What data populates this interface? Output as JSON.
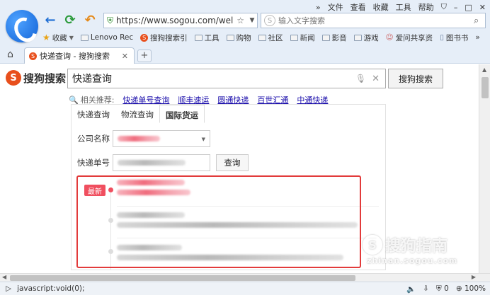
{
  "browser": {
    "menu": [
      "»",
      "文件",
      "查看",
      "收藏",
      "工具",
      "帮助"
    ],
    "window_controls": [
      "shirt-icon",
      "minimize",
      "maximize",
      "close"
    ],
    "address": "https://www.sogou.com/wel",
    "search_placeholder": "输入文字搜索",
    "bookmarks": [
      {
        "label": "收藏",
        "icon": "star-icon"
      },
      {
        "label": "Lenovo Rec",
        "icon": "folder-icon"
      },
      {
        "label": "搜狗搜索引",
        "icon": "sogou-icon"
      },
      {
        "label": "工具",
        "icon": "folder-icon"
      },
      {
        "label": "购物",
        "icon": "folder-icon"
      },
      {
        "label": "社区",
        "icon": "folder-icon"
      },
      {
        "label": "新闻",
        "icon": "folder-icon"
      },
      {
        "label": "影音",
        "icon": "folder-icon"
      },
      {
        "label": "游戏",
        "icon": "folder-icon"
      },
      {
        "label": "爱问共享资",
        "icon": "user-icon"
      },
      {
        "label": "图书书",
        "icon": "page-icon"
      }
    ],
    "tab_title": "快递查询 - 搜狗搜索",
    "status_url": "javascript:void(0);",
    "zoom": "100%",
    "status_count": "0"
  },
  "search": {
    "logo_text": "搜狗搜索",
    "query": "快递查询",
    "button": "搜狗搜索",
    "related_label": "相关推荐:",
    "related": [
      "快递单号查询",
      "顺丰速运",
      "圆通快递",
      "百世汇通",
      "中通快递"
    ]
  },
  "widget": {
    "tabs": [
      "快递查询",
      "物流查询",
      "国际货运"
    ],
    "active_tab": 2,
    "company_label": "公司名称",
    "number_label": "快递单号",
    "query_button": "查询",
    "latest_badge": "最新"
  },
  "watermark": {
    "brand": "搜狗指南",
    "domain": "zhinan.sogou.com"
  },
  "colors": {
    "highlight": "#e23b3b",
    "badge": "#f04f5f",
    "link": "#1a0dab",
    "sogou_orange": "#e84f1c"
  }
}
